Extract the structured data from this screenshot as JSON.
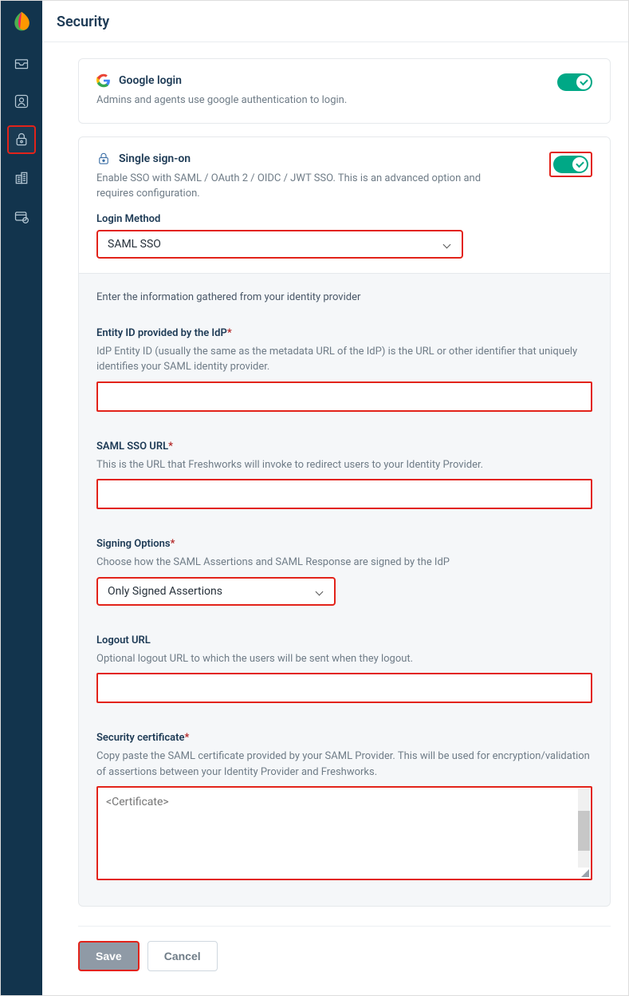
{
  "page": {
    "title": "Security"
  },
  "google_login": {
    "title": "Google login",
    "description": "Admins and agents use google authentication to login.",
    "enabled": true
  },
  "sso": {
    "title": "Single sign-on",
    "description": "Enable SSO with SAML / OAuth 2 / OIDC / JWT SSO. This is an advanced option and requires configuration.",
    "enabled": true,
    "login_method_label": "Login Method",
    "login_method_value": "SAML SSO"
  },
  "config": {
    "intro": "Enter the information gathered from your identity provider",
    "entity_id": {
      "label": "Entity ID provided by the IdP",
      "help": "IdP Entity ID (usually the same as the metadata URL of the IdP) is the URL or other identifier that uniquely identifies your SAML identity provider.",
      "value": ""
    },
    "sso_url": {
      "label": "SAML SSO URL",
      "help": "This is the URL that Freshworks will invoke to redirect users to your Identity Provider.",
      "value": ""
    },
    "signing": {
      "label": "Signing Options",
      "help": "Choose how the SAML Assertions and SAML Response are signed by the IdP",
      "value": "Only Signed Assertions"
    },
    "logout_url": {
      "label": "Logout URL",
      "help": "Optional logout URL to which the users will be sent when they logout.",
      "value": ""
    },
    "cert": {
      "label": "Security certificate",
      "help": "Copy paste the SAML certificate provided by your SAML Provider. This will be used for encryption/validation of assertions between your Identity Provider and Freshworks.",
      "placeholder": "<Certificate>"
    }
  },
  "actions": {
    "save": "Save",
    "cancel": "Cancel"
  }
}
